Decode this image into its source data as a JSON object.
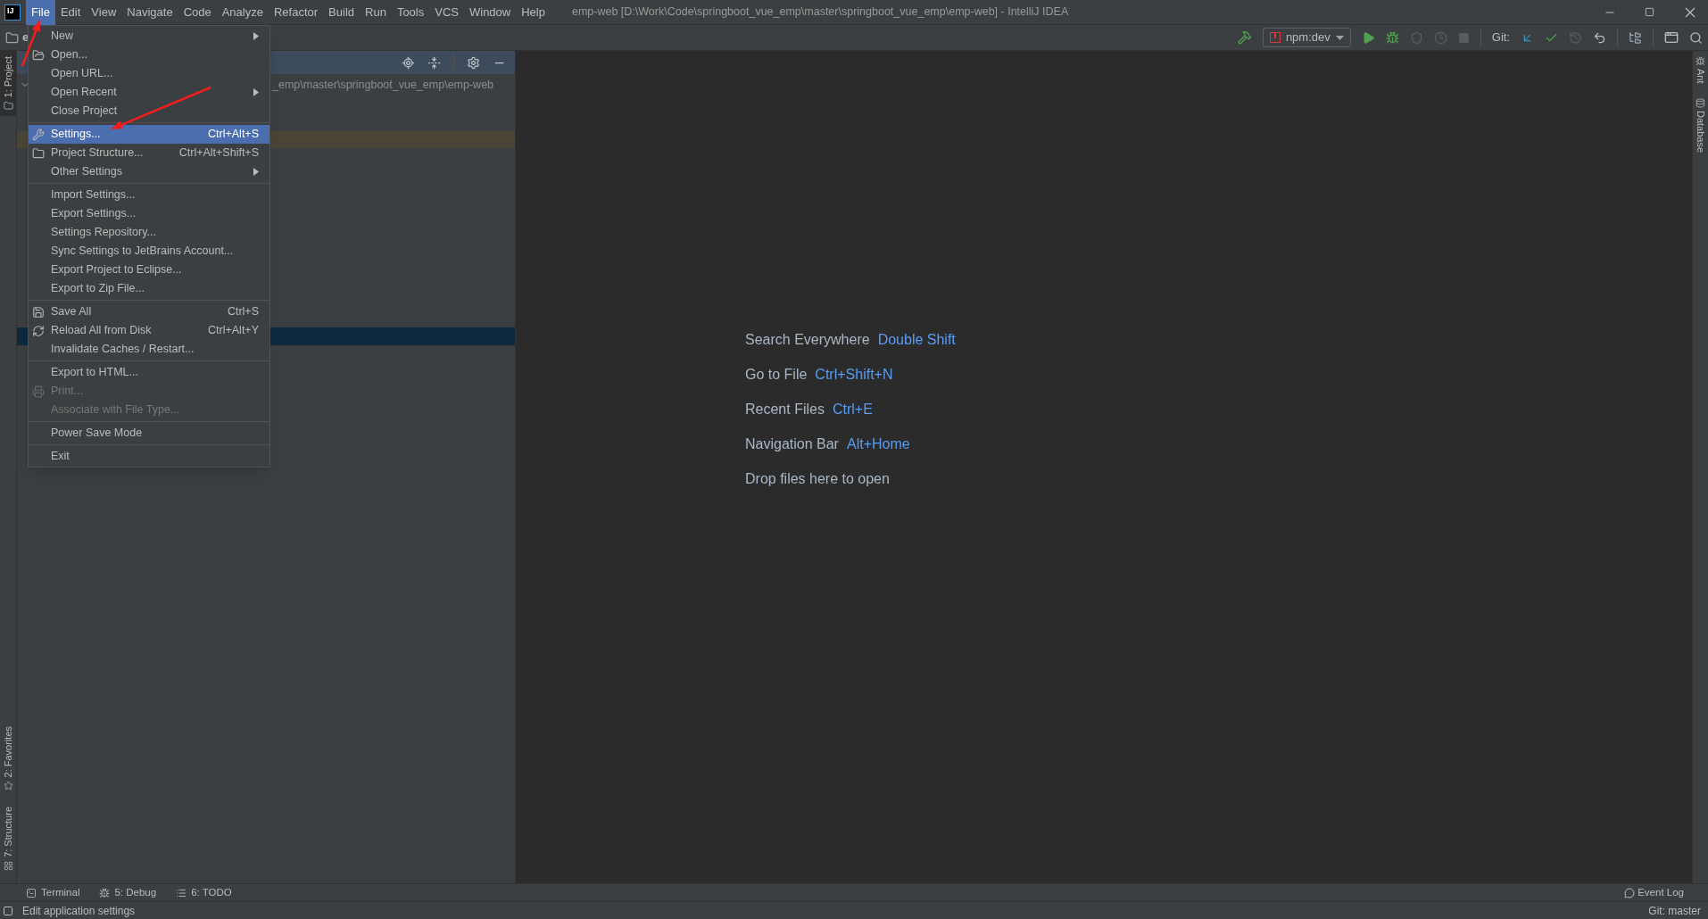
{
  "window": {
    "logo": "IJ",
    "title": "emp-web [D:\\Work\\Code\\springboot_vue_emp\\master\\springboot_vue_emp\\emp-web] - IntelliJ IDEA"
  },
  "menu_bar": [
    {
      "label": "File",
      "selected": true
    },
    {
      "label": "Edit",
      "selected": false
    },
    {
      "label": "View",
      "selected": false
    },
    {
      "label": "Navigate",
      "selected": false
    },
    {
      "label": "Code",
      "selected": false
    },
    {
      "label": "Analyze",
      "selected": false
    },
    {
      "label": "Refactor",
      "selected": false
    },
    {
      "label": "Build",
      "selected": false
    },
    {
      "label": "Run",
      "selected": false
    },
    {
      "label": "Tools",
      "selected": false
    },
    {
      "label": "VCS",
      "selected": false
    },
    {
      "label": "Window",
      "selected": false
    },
    {
      "label": "Help",
      "selected": false
    }
  ],
  "toolbar": {
    "breadcrumb": "e",
    "run_config": "npm:dev",
    "git_label": "Git:"
  },
  "left_tool_tabs": [
    {
      "label": "1: Project",
      "selected": true
    },
    {
      "label": "2: Favorites",
      "selected": false
    },
    {
      "label": "7: Structure",
      "selected": false
    }
  ],
  "right_tool_tabs": [
    {
      "label": "Ant"
    },
    {
      "label": "Database"
    }
  ],
  "project_panel": {
    "path": "_emp\\master\\springboot_vue_emp\\emp-web"
  },
  "file_menu": [
    {
      "kind": "item",
      "label": "New",
      "submenu": true,
      "selected": false,
      "disabled": false
    },
    {
      "kind": "item",
      "label": "Open...",
      "selected": false,
      "disabled": false
    },
    {
      "kind": "item",
      "label": "Open URL...",
      "selected": false,
      "disabled": false
    },
    {
      "kind": "item",
      "label": "Open Recent",
      "submenu": true,
      "selected": false,
      "disabled": false
    },
    {
      "kind": "item",
      "label": "Close Project",
      "selected": false,
      "disabled": false
    },
    {
      "kind": "separator"
    },
    {
      "kind": "item",
      "label": "Settings...",
      "shortcut": "Ctrl+Alt+S",
      "selected": true,
      "disabled": false
    },
    {
      "kind": "item",
      "label": "Project Structure...",
      "shortcut": "Ctrl+Alt+Shift+S",
      "selected": false,
      "disabled": false
    },
    {
      "kind": "item",
      "label": "Other Settings",
      "submenu": true,
      "selected": false,
      "disabled": false
    },
    {
      "kind": "separator"
    },
    {
      "kind": "item",
      "label": "Import Settings...",
      "selected": false,
      "disabled": false
    },
    {
      "kind": "item",
      "label": "Export Settings...",
      "selected": false,
      "disabled": false
    },
    {
      "kind": "item",
      "label": "Settings Repository...",
      "selected": false,
      "disabled": false
    },
    {
      "kind": "item",
      "label": "Sync Settings to JetBrains Account...",
      "selected": false,
      "disabled": false
    },
    {
      "kind": "item",
      "label": "Export Project to Eclipse...",
      "selected": false,
      "disabled": false
    },
    {
      "kind": "item",
      "label": "Export to Zip File...",
      "selected": false,
      "disabled": false
    },
    {
      "kind": "separator"
    },
    {
      "kind": "item",
      "label": "Save All",
      "shortcut": "Ctrl+S",
      "selected": false,
      "disabled": false
    },
    {
      "kind": "item",
      "label": "Reload All from Disk",
      "shortcut": "Ctrl+Alt+Y",
      "selected": false,
      "disabled": false
    },
    {
      "kind": "item",
      "label": "Invalidate Caches / Restart...",
      "selected": false,
      "disabled": false
    },
    {
      "kind": "separator"
    },
    {
      "kind": "item",
      "label": "Export to HTML...",
      "selected": false,
      "disabled": false
    },
    {
      "kind": "item",
      "label": "Print...",
      "selected": false,
      "disabled": true
    },
    {
      "kind": "item",
      "label": "Associate with File Type...",
      "selected": false,
      "disabled": true
    },
    {
      "kind": "separator"
    },
    {
      "kind": "item",
      "label": "Power Save Mode",
      "selected": false,
      "disabled": false
    },
    {
      "kind": "separator"
    },
    {
      "kind": "item",
      "label": "Exit",
      "selected": false,
      "disabled": false
    }
  ],
  "editor_hints": [
    {
      "label": "Search Everywhere",
      "shortcut": "Double Shift"
    },
    {
      "label": "Go to File",
      "shortcut": "Ctrl+Shift+N"
    },
    {
      "label": "Recent Files",
      "shortcut": "Ctrl+E"
    },
    {
      "label": "Navigation Bar",
      "shortcut": "Alt+Home"
    },
    {
      "label": "Drop files here to open"
    }
  ],
  "bottom_tabs": [
    {
      "label": "Terminal"
    },
    {
      "label": "5: Debug"
    },
    {
      "label": "6: TODO"
    }
  ],
  "status_bar": {
    "message": "Edit application settings",
    "event_log": "Event Log",
    "git_branch": "Git: master"
  }
}
